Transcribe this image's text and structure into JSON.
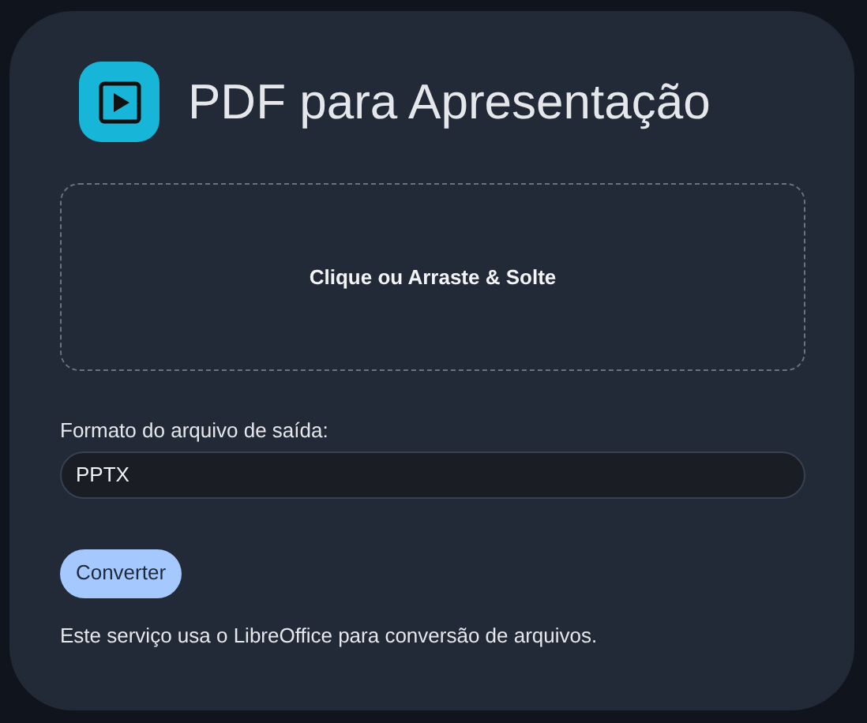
{
  "title": "PDF para Apresentação",
  "dropzone": {
    "label": "Clique ou Arraste & Solte"
  },
  "format_field": {
    "label": "Formato do arquivo de saída:",
    "value": "PPTX"
  },
  "convert_button": {
    "label": "Converter"
  },
  "footer_note": "Este serviço usa o LibreOffice para conversão de arquivos."
}
